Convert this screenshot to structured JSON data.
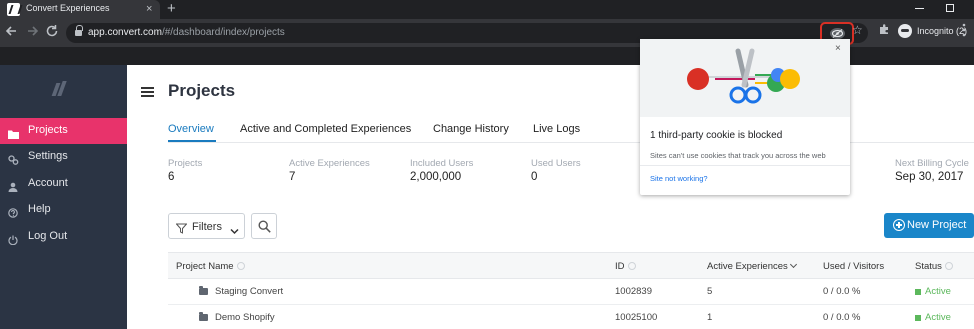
{
  "browser": {
    "tab_title": "Convert Experiences",
    "tab_close": "×",
    "new_tab": "+",
    "url_host": "app.convert.com",
    "url_path": "/#/dashboard/index/projects",
    "profile_label": "Incognito (2)",
    "icons": [
      "back-arrow-icon",
      "forward-arrow-icon",
      "reload-icon",
      "lock-icon",
      "cookie-blocked-eye-icon",
      "star-icon",
      "extensions-puzzle-icon",
      "incognito-icon",
      "menu-dots-icon"
    ],
    "highlight_color": "#d93025"
  },
  "sidebar": {
    "accent": "#e8336b",
    "items": [
      {
        "label": "Projects",
        "icon": "projects-icon",
        "active": true
      },
      {
        "label": "Settings",
        "icon": "settings-icon",
        "active": false
      },
      {
        "label": "Account",
        "icon": "account-icon",
        "active": false
      },
      {
        "label": "Help",
        "icon": "help-icon",
        "active": false
      },
      {
        "label": "Log Out",
        "icon": "logout-icon",
        "active": false
      }
    ]
  },
  "main": {
    "title": "Projects",
    "tabs": [
      {
        "label": "Overview",
        "active": true
      },
      {
        "label": "Active and Completed Experiences",
        "active": false
      },
      {
        "label": "Change History",
        "active": false
      },
      {
        "label": "Live Logs",
        "active": false
      }
    ],
    "stats": [
      {
        "label": "Projects",
        "value": "6"
      },
      {
        "label": "Active Experiences",
        "value": "7"
      },
      {
        "label": "Included Users",
        "value": "2,000,000"
      },
      {
        "label": "Used Users",
        "value": "0"
      },
      {
        "label": "Next Billing Cycle",
        "value": "Sep 30, 2017"
      }
    ],
    "filters_label": "Filters",
    "new_project_label": "New Project",
    "table": {
      "columns": [
        "Project Name",
        "ID",
        "Active Experiences",
        "Used / Visitors",
        "Status"
      ],
      "rows": [
        {
          "name": "Staging Convert",
          "id": "1002839",
          "active": "5",
          "used": "0 / 0.0 %",
          "status": "Active"
        },
        {
          "name": "Demo Shopify",
          "id": "10025100",
          "active": "1",
          "used": "0 / 0.0 %",
          "status": "Active"
        }
      ]
    }
  },
  "cookie_popup": {
    "title": "1 third-party cookie is blocked",
    "description": "Sites can't use cookies that track you across the web",
    "link": "Site not working?",
    "close": "×"
  }
}
